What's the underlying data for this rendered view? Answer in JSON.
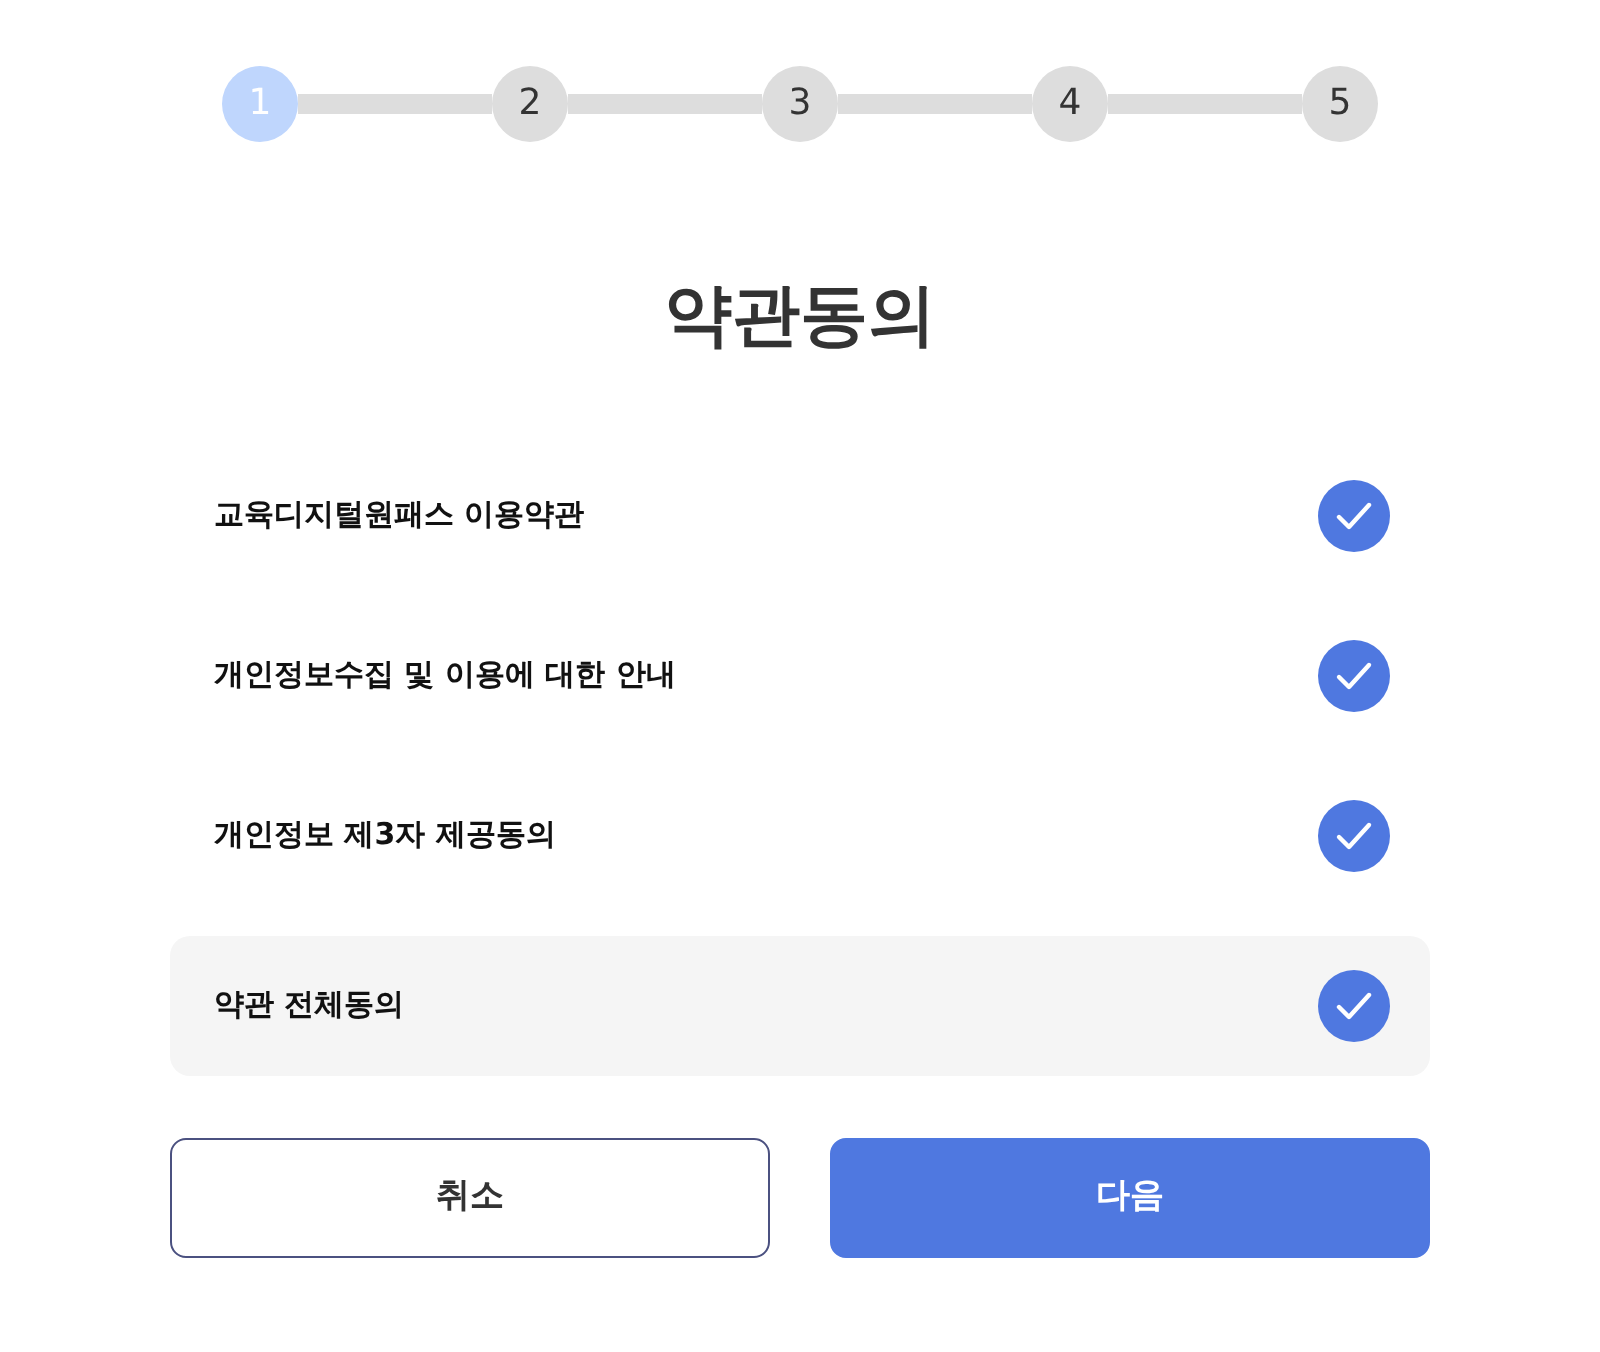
{
  "steps": [
    {
      "label": "1",
      "selected": true
    },
    {
      "label": "2",
      "selected": false
    },
    {
      "label": "3",
      "selected": false
    },
    {
      "label": "4",
      "selected": false
    },
    {
      "label": "5",
      "selected": false
    }
  ],
  "title": "약관동의",
  "agreements": [
    {
      "kind": "item",
      "label": "교육디지털원패스 이용약관",
      "checked": true
    },
    {
      "kind": "item",
      "label": "개인정보수집 및 이용에 대한 안내",
      "checked": true
    },
    {
      "kind": "item",
      "label": "개인정보 제3자 제공동의",
      "checked": true
    },
    {
      "kind": "all",
      "label": "약관 전체동의",
      "checked": true
    }
  ],
  "buttons": [
    {
      "kind": "outline",
      "label": "취소"
    },
    {
      "kind": "primary",
      "label": "다음"
    }
  ]
}
